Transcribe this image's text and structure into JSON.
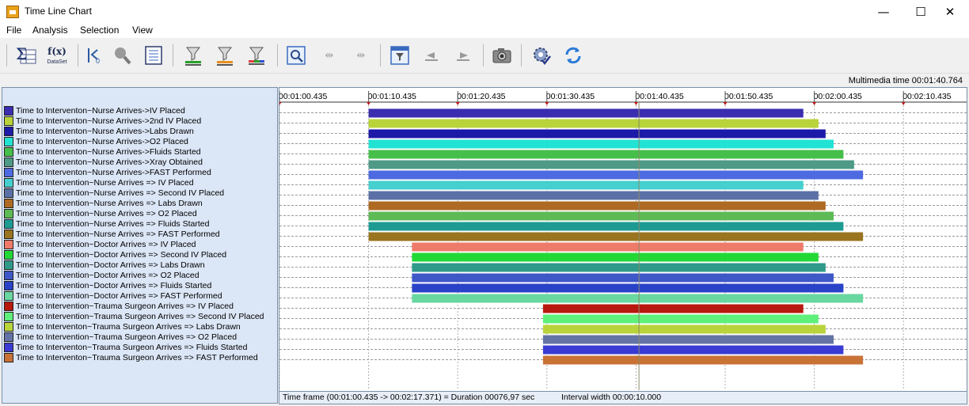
{
  "window": {
    "title": "Time Line Chart",
    "controls": {
      "minimize": "—",
      "maximize": "☐",
      "close": "✕"
    }
  },
  "menu": [
    "File",
    "Analysis",
    "Selection",
    "View"
  ],
  "toolbar": {
    "buttons": [
      {
        "name": "sum-table-icon"
      },
      {
        "name": "function-dataset-icon",
        "label_main": "f(x)",
        "label_sub": "DataSet"
      },
      {
        "name": "go-to-start-icon"
      },
      {
        "name": "magnifier-icon"
      },
      {
        "name": "list-document-icon"
      },
      {
        "name": "filter-green-icon"
      },
      {
        "name": "filter-orange-icon"
      },
      {
        "name": "filter-multicolor-icon"
      },
      {
        "name": "zoom-window-icon"
      },
      {
        "name": "zoom-in-time-icon"
      },
      {
        "name": "zoom-out-time-icon"
      },
      {
        "name": "filter-window-icon"
      },
      {
        "name": "previous-arrow-icon"
      },
      {
        "name": "next-arrow-icon"
      },
      {
        "name": "camera-icon"
      },
      {
        "name": "settings-check-icon"
      },
      {
        "name": "refresh-icon"
      }
    ]
  },
  "multimedia_time": "Multimedia time 00:01:40.764",
  "chart_data": {
    "type": "timeline",
    "ticks": [
      "00:01:00.435",
      "00:01:10.435",
      "00:01:20.435",
      "00:01:30.435",
      "00:01:40.435",
      "00:01:50.435",
      "00:02:00.435",
      "00:02:10.435"
    ],
    "range_seconds": [
      60.435,
      137.371
    ],
    "interval_seconds": 10,
    "cursor_seconds": 100.764,
    "series": [
      {
        "label": "Time to Interventon~Nurse Arrives->IV Placed",
        "color": "#3a2db0",
        "start": 70.435,
        "end": 119.2
      },
      {
        "label": "Time to Interventon~Nurse Arrives->2nd IV Placed",
        "color": "#b8d43a",
        "start": 70.435,
        "end": 120.9
      },
      {
        "label": "Time to Interventon~Nurse Arrives->Labs Drawn",
        "color": "#1c1aa8",
        "start": 70.435,
        "end": 121.7
      },
      {
        "label": "Time to Interventon~Nurse Arrives->O2 Placed",
        "color": "#22e3d3",
        "start": 70.435,
        "end": 122.6
      },
      {
        "label": "Time to Interventon~Nurse Arrives->Fluids Started",
        "color": "#46bf4a",
        "start": 70.435,
        "end": 123.7
      },
      {
        "label": "Time to Interventon~Nurse Arrives->Xray Obtained",
        "color": "#4e9a86",
        "start": 70.435,
        "end": 124.9
      },
      {
        "label": "Time to Interventon~Nurse Arrives->FAST Performed",
        "color": "#4d6ae0",
        "start": 70.435,
        "end": 125.9
      },
      {
        "label": "Time to Intervention~Nurse Arrives => IV Placed",
        "color": "#45cfcf",
        "start": 70.435,
        "end": 119.2
      },
      {
        "label": "Time to Intervention~Nurse Arrives => Second IV Placed",
        "color": "#5b70a6",
        "start": 70.435,
        "end": 120.9
      },
      {
        "label": "Time to Intervention~Nurse Arrives => Labs Drawn",
        "color": "#ae6a23",
        "start": 70.435,
        "end": 121.7
      },
      {
        "label": "Time to Intervention~Nurse Arrives => O2 Placed",
        "color": "#5dba55",
        "start": 70.435,
        "end": 122.6
      },
      {
        "label": "Time to Intervention~Nurse Arrives => Fluids Started",
        "color": "#1d9b93",
        "start": 70.435,
        "end": 123.7
      },
      {
        "label": "Time to Intervention~Nurse Arrives => FAST Performed",
        "color": "#9a7420",
        "start": 70.435,
        "end": 125.9
      },
      {
        "label": "Time to Intervention~Doctor Arrives => IV Placed",
        "color": "#ee7a6a",
        "start": 75.3,
        "end": 119.2
      },
      {
        "label": "Time to Intervention~Doctor Arrives => Second IV Placed",
        "color": "#22d836",
        "start": 75.3,
        "end": 120.9
      },
      {
        "label": "Time to Intervention~Doctor Arrives => Labs Drawn",
        "color": "#2f9a8a",
        "start": 75.3,
        "end": 121.7
      },
      {
        "label": "Time to Intervention~Doctor Arrives => O2 Placed",
        "color": "#3e58c8",
        "start": 75.3,
        "end": 122.6
      },
      {
        "label": "Time to Intervention~Doctor Arrives => Fluids Started",
        "color": "#2842c8",
        "start": 75.3,
        "end": 123.7
      },
      {
        "label": "Time to Intervention~Doctor Arrives => FAST Performed",
        "color": "#68d7a0",
        "start": 75.3,
        "end": 125.9
      },
      {
        "label": "Time to Intervention~Trauma Surgeon Arrives => IV Placed",
        "color": "#b8180e",
        "start": 90.0,
        "end": 119.2
      },
      {
        "label": "Time to Intervention~Trauma Surgeon Arrives => Second IV Placed",
        "color": "#5ef07a",
        "start": 90.0,
        "end": 120.9
      },
      {
        "label": "Time to Interventon~Trauma Surgeon Arrives => Labs Drawn",
        "color": "#b8d43a",
        "start": 90.0,
        "end": 121.7
      },
      {
        "label": "Time to Intervention~Trauma Surgeon Arrives => O2 Placed",
        "color": "#6473a6",
        "start": 90.0,
        "end": 122.6
      },
      {
        "label": "Time to Interventon~Trauma Surgeon Arrives => Fluids Started",
        "color": "#3a3ad4",
        "start": 90.0,
        "end": 123.7
      },
      {
        "label": "Time to Interventon~Trauma Surgeon Arrives => FAST Performed",
        "color": "#c97236",
        "start": 90.0,
        "end": 125.9
      }
    ]
  },
  "status": {
    "time_frame": "Time frame  (00:01:00.435 -> 00:02:17.371) = Duration 00076,97 sec",
    "interval": "Interval width 00:00:10.000"
  }
}
